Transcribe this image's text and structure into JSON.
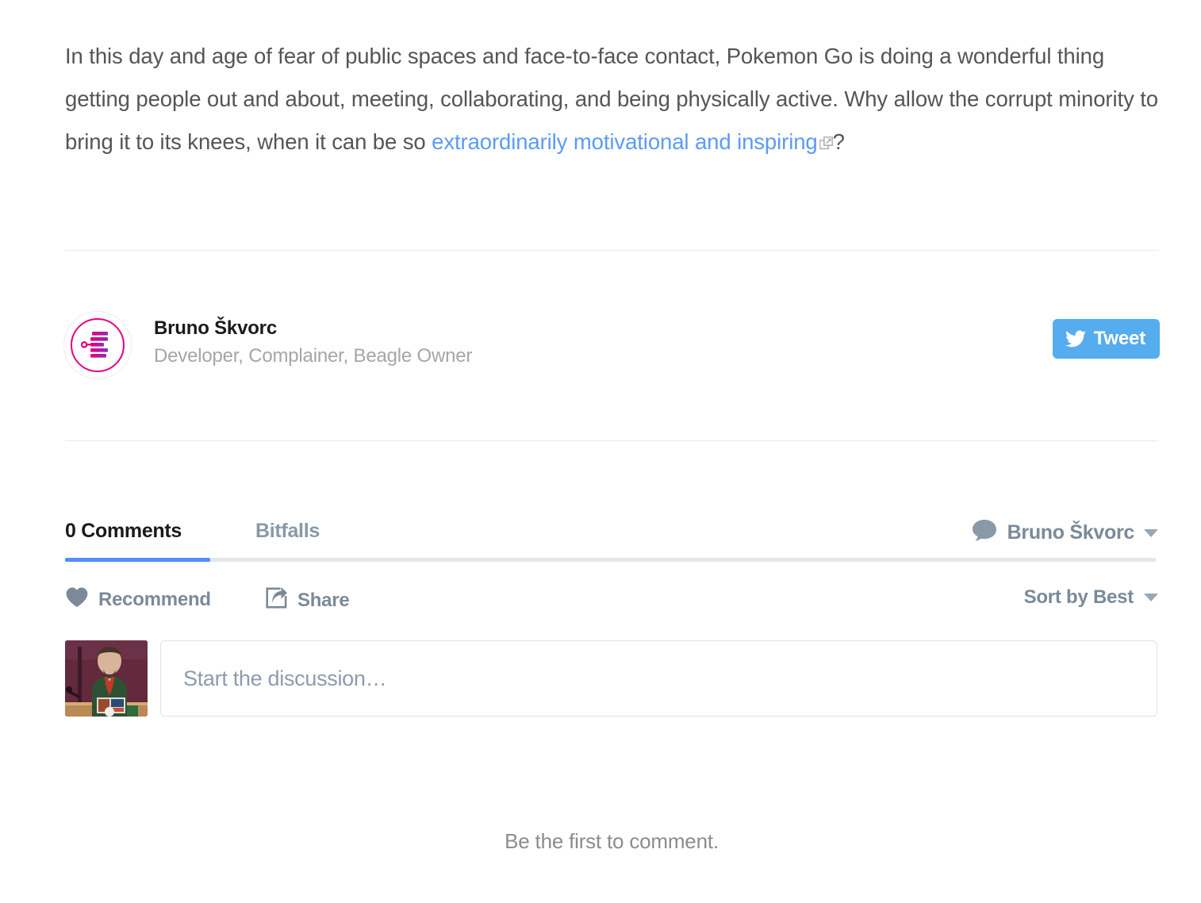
{
  "article": {
    "paragraph_part1": "In this day and age of fear of public spaces and face-to-face contact, Pokemon Go is doing a wonderful thing getting people out and about, meeting, collaborating, and being physically active. Why allow the corrupt minority to bring it to its knees, when it can be so ",
    "link_text": "extraordinarily motivational and inspiring",
    "paragraph_part2": "?",
    "link_color": "#5b9bf4",
    "text_color": "#555555",
    "external_link_icon": "external-link-icon"
  },
  "author": {
    "name": "Bruno Škvorc",
    "tagline": "Developer, Complainer, Beagle Owner",
    "avatar_icon": "bitfalls-logo-icon",
    "avatar_accent": "#e6007e"
  },
  "tweet": {
    "label": "Tweet",
    "icon": "twitter-bird-icon",
    "background": "#55acee",
    "text_color": "#ffffff"
  },
  "disqus": {
    "tabs": [
      {
        "label": "0 Comments",
        "active": true
      },
      {
        "label": "Bitfalls",
        "active": false
      }
    ],
    "active_underline_color": "#4f8ef7",
    "user": {
      "name": "Bruno Škvorc",
      "icon": "speech-bubble-icon",
      "caret": "chevron-down-icon"
    },
    "actions": [
      {
        "label": "Recommend",
        "icon": "heart-icon"
      },
      {
        "label": "Share",
        "icon": "share-icon"
      }
    ],
    "sort": {
      "label": "Sort by Best",
      "caret": "chevron-down-icon"
    },
    "compose": {
      "placeholder": "Start the discussion…",
      "avatar_icon": "user-photo-avatar"
    },
    "empty_state": "Be the first to comment."
  }
}
